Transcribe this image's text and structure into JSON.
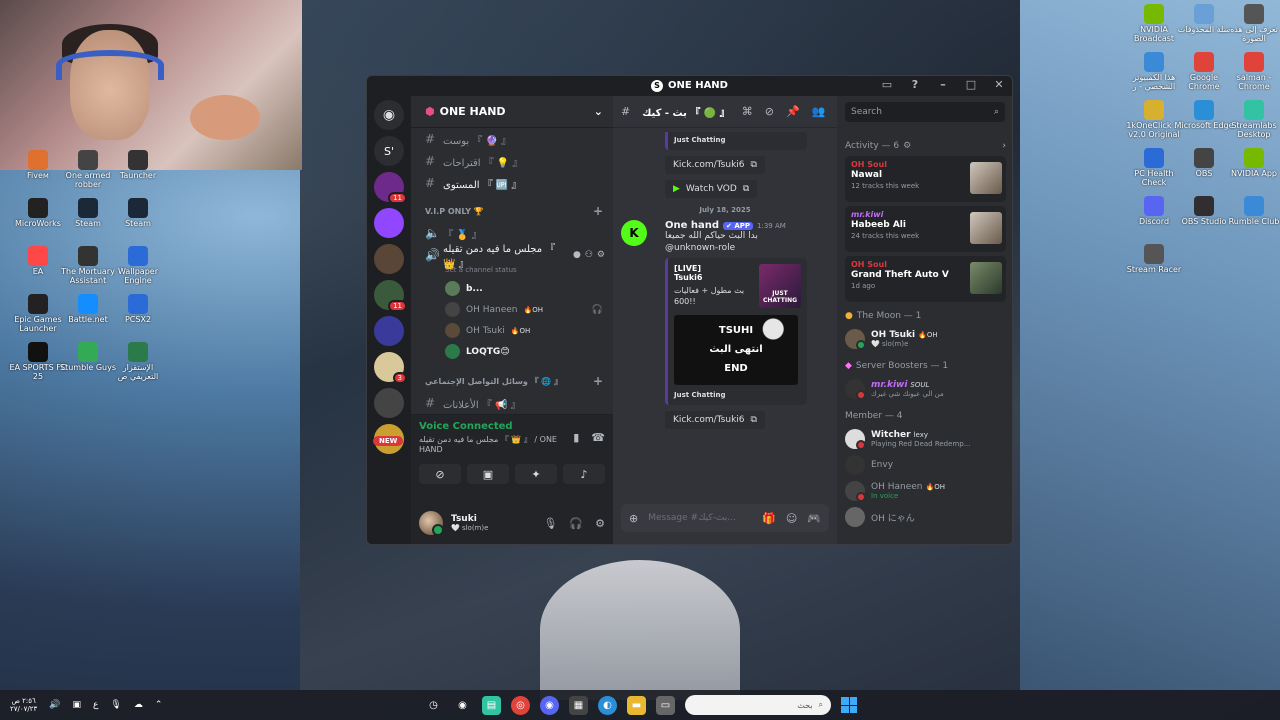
{
  "window": {
    "title": "ONE HAND",
    "title_initial": "S"
  },
  "servers": [
    {
      "label": "S'",
      "color": "#2b2d31"
    },
    {
      "label": "",
      "color": "#6e2a8a",
      "badge": "11"
    },
    {
      "label": "",
      "color": "#9146ff"
    },
    {
      "label": "",
      "color": "#5a4636"
    },
    {
      "label": "",
      "color": "#3b5a3b",
      "badge": "11"
    },
    {
      "label": "",
      "color": "#3a3a9a"
    },
    {
      "label": "",
      "color": "#d9c99a",
      "badge": "3"
    },
    {
      "label": "",
      "color": "#444"
    },
    {
      "label": "",
      "color": "#c9a030"
    }
  ],
  "new_pill": "NEW",
  "guild": {
    "name": "ONE HAND"
  },
  "channels": {
    "top": [
      {
        "name": "بوست 『 🔮 』"
      },
      {
        "name": "اقتراحات 『 💡 』"
      },
      {
        "name": "المستوى 『 🆙 』",
        "bright": true
      }
    ],
    "vip_category": "V.I.P ONLY 🏆",
    "vip_channel": "『 🥇 』",
    "voice_channel": "مجلس ما فيه دمن تقيله 『 👑 』",
    "voice_status": "Set a channel status",
    "voice_users": [
      {
        "name": "b...",
        "bold": true,
        "tag": ""
      },
      {
        "name": "OH Haneen",
        "bold": false,
        "tag": "🔥OH",
        "deaf": true
      },
      {
        "name": "OH Tsuki",
        "bold": false,
        "tag": "🔥OH"
      },
      {
        "name": "LOQTG😊",
        "bold": true,
        "tag": ""
      }
    ],
    "social_category": "وسائل التواصل الإجتماعي 『 🌐 』",
    "social_channels": [
      {
        "name": "الأعلانات 『 📢 』"
      },
      {
        "name": "بث - كيك 『 🟢 』",
        "active": true
      }
    ]
  },
  "voice_panel": {
    "status": "Voice Connected",
    "channel": "مجلس ما فيه دمن تقيله 『 👑 』 / ONE HAND"
  },
  "user": {
    "name": "Tsuki",
    "status": "🤍 slo(m)e"
  },
  "chat": {
    "channel_name": "بث - كيك 『 🟢 』",
    "top_embed_category": "Just Chatting",
    "top_link": "Kick.com/Tsuki6",
    "watch_vod": "Watch VOD",
    "date": "July 18, 2025",
    "message": {
      "avatar": "K",
      "author": "One hand",
      "app_badge": "✔ APP",
      "time": "1:39 AM",
      "text": "بدا البث حياكم الله جميعا",
      "mention": "@unknown-role"
    },
    "embed": {
      "live": "[LIVE]",
      "streamer": "Tsuki6",
      "description": "بث مطول + فعاليات 600!!",
      "thumb_text": "JUST CHATTING",
      "image_lines": [
        "TSUHI",
        "انتهى البث",
        "END"
      ],
      "category": "Just Chatting"
    },
    "bottom_link": "Kick.com/Tsuki6",
    "composer_placeholder": "Message #بث-كيك..."
  },
  "members": {
    "search_placeholder": "Search",
    "activity_header": "Activity — 6",
    "activities": [
      {
        "who": "OH Soul",
        "title": "Nawal",
        "sub": "12 tracks this week",
        "purple": false
      },
      {
        "who": "mr.kiwi",
        "title": "Habeeb Ali",
        "sub": "24 tracks this week",
        "purple": true
      },
      {
        "who": "OH Soul",
        "title": "Grand Theft Auto V",
        "sub": "1d ago",
        "purple": false
      }
    ],
    "moon_header": "The Moon — 1",
    "moon_member": {
      "name": "OH Tsuki",
      "tag": "🔥OH",
      "status": "🤍 slo(m)e"
    },
    "boosters_header": "Server Boosters — 1",
    "booster": {
      "name": "mr.kiwi",
      "tag": "SOUL",
      "status": "من الي عيونك شي غيرك"
    },
    "member_header": "Member — 4",
    "member_list": [
      {
        "name": "Witcher",
        "tag": "lexy",
        "status": "Playing Red Dead Redemp...",
        "dim": false,
        "green": false
      },
      {
        "name": "Envy",
        "tag": "",
        "status": "",
        "dim": true,
        "green": false
      },
      {
        "name": "OH Haneen",
        "tag": "🔥OH",
        "status": "In voice",
        "dim": true,
        "green": true
      },
      {
        "name": "OH にゃん",
        "tag": "",
        "status": "",
        "dim": true,
        "green": false
      }
    ]
  },
  "desktop_icons_left": [
    {
      "label": "Fiveм",
      "color": "#e07030"
    },
    {
      "label": "One armed robber",
      "color": "#444"
    },
    {
      "label": "Tauncher",
      "color": "#333"
    },
    {
      "label": "MicroWorks",
      "color": "#222"
    },
    {
      "label": "Steam",
      "color": "#1b2838"
    },
    {
      "label": "Steam",
      "color": "#1b2838"
    },
    {
      "label": "EA",
      "color": "#ff4747"
    },
    {
      "label": "The Mortuary Assistant",
      "color": "#333"
    },
    {
      "label": "Wallpaper Engine",
      "color": "#2a6bd8"
    },
    {
      "label": "Epic Games Launcher",
      "color": "#222"
    },
    {
      "label": "Battle.net",
      "color": "#148eff"
    },
    {
      "label": "PCSX2",
      "color": "#2a6bd8"
    },
    {
      "label": "EA SPORTS FC 25",
      "color": "#111"
    },
    {
      "label": "Stumble Guys",
      "color": "#33aa55"
    },
    {
      "label": "الإستقرار التعريفي ص",
      "color": "#2a7a4a"
    }
  ],
  "desktop_icons_right": [
    {
      "label": "NVIDIA Broadcast",
      "color": "#76b900"
    },
    {
      "label": "سلة المحذوفات",
      "color": "#6aa0d8"
    },
    {
      "label": "تعرف إلى هذه الصورة",
      "color": "#555"
    },
    {
      "label": "هذا الكمبيوتر الشخصي - ر",
      "color": "#3a8ad8"
    },
    {
      "label": "Google Chrome",
      "color": "#e0433a"
    },
    {
      "label": "salman - Chrome",
      "color": "#e0433a"
    },
    {
      "label": "1kOneClick ... v2.0 Original",
      "color": "#d8b030"
    },
    {
      "label": "Microsoft Edge",
      "color": "#2b8fd8"
    },
    {
      "label": "Streamlabs Desktop",
      "color": "#31c3a2"
    },
    {
      "label": "PC Health Check",
      "color": "#2a6bd8"
    },
    {
      "label": "OBS",
      "color": "#444"
    },
    {
      "label": "NVIDIA App",
      "color": "#76b900"
    },
    {
      "label": "Discord",
      "color": "#5865f2"
    },
    {
      "label": "OBS Studio",
      "color": "#302e31"
    },
    {
      "label": "Rumble Club",
      "color": "#3a8ad8"
    },
    {
      "label": "Stream Racer",
      "color": "#555"
    }
  ],
  "taskbar": {
    "time": "٢:٥٦ ص",
    "date": "٢٧/٠٧/٢٣",
    "lang": "ع",
    "search_placeholder": "بحث"
  }
}
